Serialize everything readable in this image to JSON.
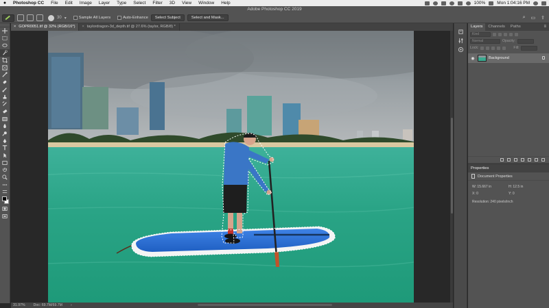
{
  "menubar": {
    "app_name": "Photoshop CC",
    "items": [
      "File",
      "Edit",
      "Image",
      "Layer",
      "Type",
      "Select",
      "Filter",
      "3D",
      "View",
      "Window",
      "Help"
    ],
    "battery": "100%",
    "clock": "Mon 1:04:16 PM"
  },
  "options": {
    "app_title": "Adobe Photoshop CC 2019",
    "brush_size": "30",
    "sample_all_layers": "Sample All Layers",
    "auto_enhance": "Auto-Enhance",
    "select_subject": "Select Subject",
    "select_and_mask": "Select and Mask..."
  },
  "tabs": [
    {
      "label": "GOPR0051.tif @ 32% (RGB/16*)",
      "close": "×"
    },
    {
      "label": "taylordragon-3d_depth.tif @ 27.6% (taylor, RGB/8) *",
      "close": "×"
    }
  ],
  "status": {
    "zoom": "31.97%",
    "doc": "Doc: 69.7M/69.7M",
    "arrow": "›"
  },
  "layers_panel": {
    "tabs": [
      "Layers",
      "Channels",
      "Paths"
    ],
    "filter_kind": "Kind",
    "blend_mode": "Normal",
    "opacity_label": "Opacity:",
    "lock_label": "Lock:",
    "fill_label": "Fill:",
    "layer_name": "Background"
  },
  "properties": {
    "title": "Properties",
    "subtitle": "Document Properties",
    "w": "W: 15.667 in",
    "h": "H: 12.5 in",
    "x": "X: 0",
    "y": "Y: 0",
    "resolution": "Resolution: 240 pixels/inch"
  },
  "colors": {
    "water": "#2fa486",
    "sky": "#8c9397",
    "board": "#2f74d8",
    "shirt": "#3a76c6"
  }
}
